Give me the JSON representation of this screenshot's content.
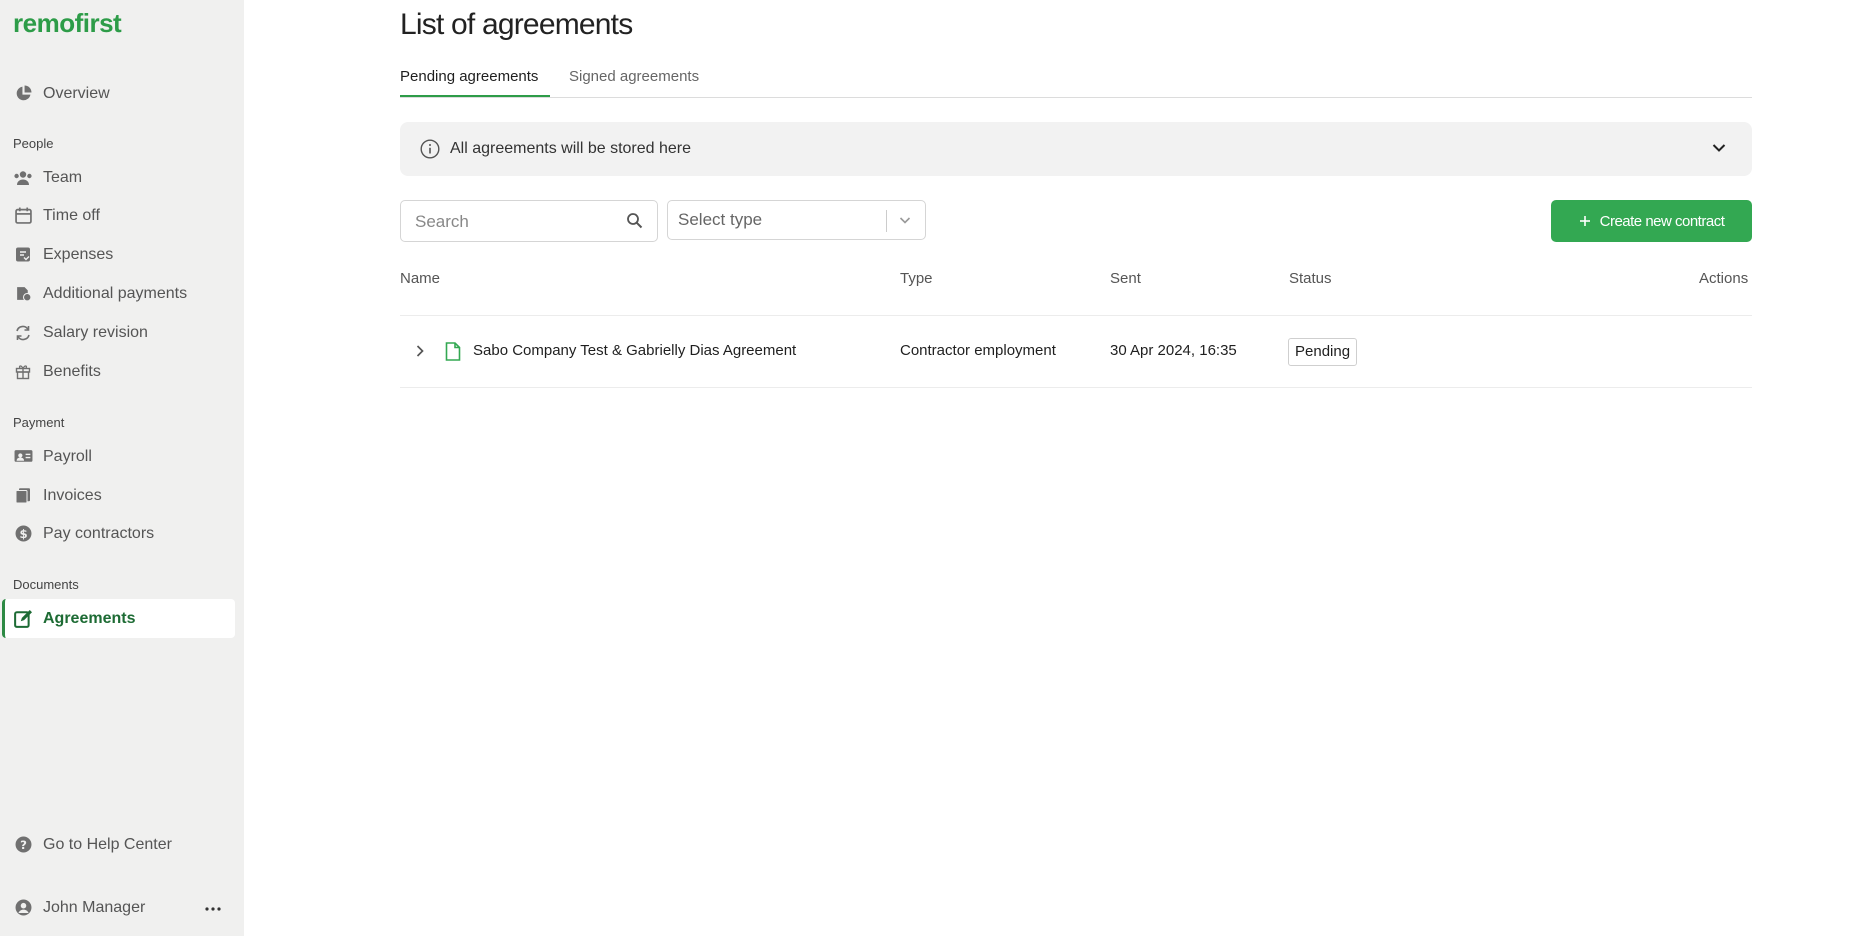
{
  "brand": {
    "logo": "remofirst"
  },
  "sidebar": {
    "overview": "Overview",
    "sections": {
      "people": "People",
      "payment": "Payment",
      "documents": "Documents"
    },
    "people_items": [
      "Team",
      "Time off",
      "Expenses",
      "Additional payments",
      "Salary revision",
      "Benefits"
    ],
    "payment_items": [
      "Payroll",
      "Invoices",
      "Pay contractors"
    ],
    "documents_items": [
      "Agreements"
    ],
    "help": "Go to Help Center",
    "user": "John Manager",
    "active_color": "#1d6b34"
  },
  "page": {
    "title": "List of agreements",
    "tabs": [
      "Pending agreements",
      "Signed agreements"
    ],
    "info": "All agreements will be stored here",
    "search_placeholder": "Search",
    "select_placeholder": "Select type",
    "create_label": "Create new contract",
    "accent": "#33a852"
  },
  "table": {
    "headers": [
      "Name",
      "Type",
      "Sent",
      "Status",
      "Actions"
    ],
    "rows": [
      {
        "name": "Sabo Company Test & Gabrielly Dias Agreement",
        "type": "Contractor employment",
        "sent": "30 Apr 2024, 16:35",
        "status": "Pending"
      }
    ]
  }
}
